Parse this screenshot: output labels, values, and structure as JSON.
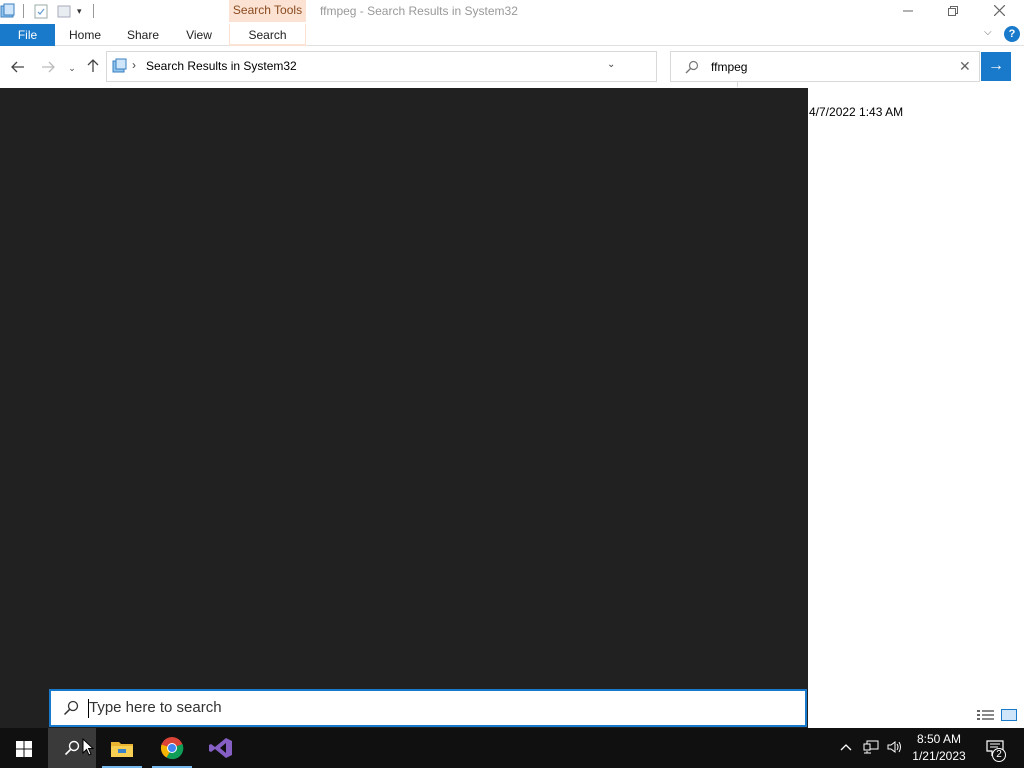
{
  "window": {
    "title": "ffmpeg - Search Results in System32",
    "context_tab_group": "Search Tools",
    "minimize_icon": "minimize-icon",
    "maximize_icon": "restore-icon",
    "close_icon": "close-icon"
  },
  "ribbon": {
    "file_tab": "File",
    "tabs": [
      {
        "label": "Home"
      },
      {
        "label": "Share"
      },
      {
        "label": "View"
      },
      {
        "label": "Search"
      }
    ],
    "help_label": "?",
    "accent_color": "#1979ca",
    "context_color": "#fbe2d2"
  },
  "nav": {
    "address_path": "Search Results in System32",
    "search_value": "ffmpeg"
  },
  "content": {
    "date_modified": "4/7/2022 1:43 AM"
  },
  "taskbar": {
    "search_placeholder": "Type here to search",
    "time": "8:50 AM",
    "date": "1/21/2023",
    "notification_count": "2",
    "pinned": [
      "file-explorer-icon",
      "chrome-icon",
      "visual-studio-icon"
    ]
  }
}
